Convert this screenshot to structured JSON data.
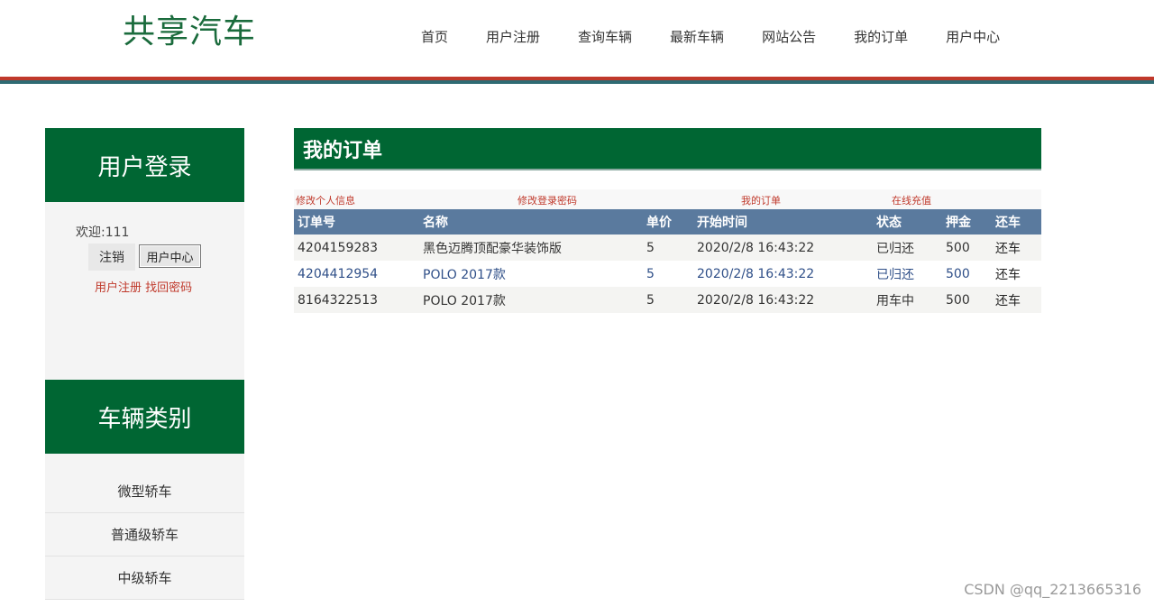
{
  "header": {
    "logo": "共享汽车",
    "nav": [
      "首页",
      "用户注册",
      "查询车辆",
      "最新车辆",
      "网站公告",
      "我的订单",
      "用户中心"
    ]
  },
  "sidebar": {
    "login_title": "用户登录",
    "welcome": "欢迎:111",
    "logout_label": "注销",
    "user_center_label": "用户中心",
    "register_link": "用户注册",
    "find_password_link": "找回密码",
    "category_title": "车辆类别",
    "categories": [
      "微型轿车",
      "普通级轿车",
      "中级轿车"
    ]
  },
  "main": {
    "title": "我的订单",
    "sub_links": [
      "修改个人信息",
      "修改登录密码",
      "我的订单",
      "在线充值"
    ],
    "table": {
      "headers": [
        "订单号",
        "名称",
        "单价",
        "开始时间",
        "状态",
        "押金",
        "还车"
      ],
      "rows": [
        [
          "4204159283",
          "黑色迈腾顶配豪华装饰版",
          "5",
          "2020/2/8 16:43:22",
          "已归还",
          "500",
          "还车"
        ],
        [
          "4204412954",
          "POLO 2017款",
          "5",
          "2020/2/8 16:43:22",
          "已归还",
          "500",
          "还车"
        ],
        [
          "8164322513",
          "POLO 2017款",
          "5",
          "2020/2/8 16:43:22",
          "用车中",
          "500",
          "还车"
        ]
      ]
    }
  },
  "watermark": "CSDN @qq_2213665316",
  "colors": {
    "brand_green": "#006633",
    "header_red": "#c0392b",
    "table_header": "#5a7a9e"
  }
}
